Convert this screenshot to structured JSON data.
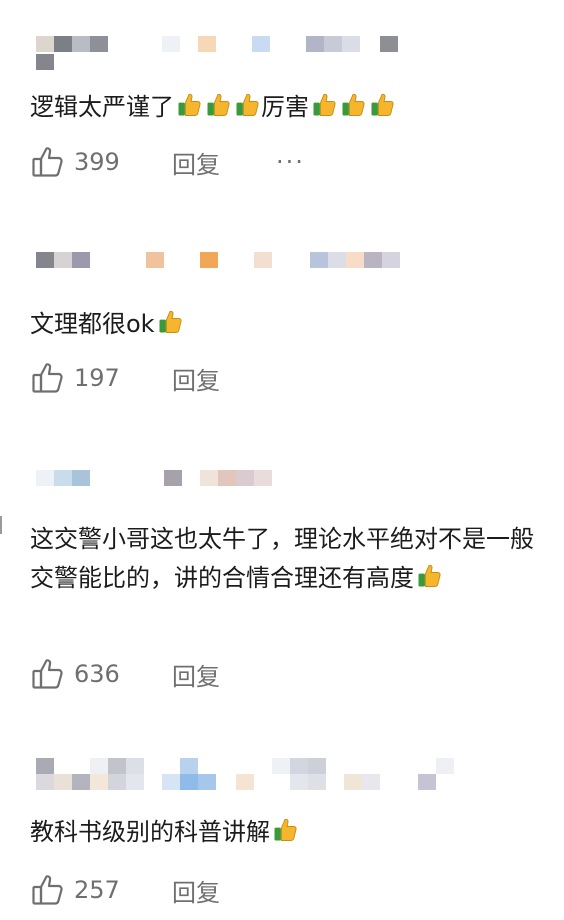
{
  "comments": [
    {
      "text": "逻辑太严谨了",
      "suffix": "厉害",
      "likes": "399",
      "reply": "回复",
      "more": "···"
    },
    {
      "text": "文理都很ok",
      "likes": "197",
      "reply": "回复"
    },
    {
      "text": "这交警小哥这也太牛了，理论水平绝对不是一般交警能比的，讲的合情合理还有高度",
      "likes": "636",
      "reply": "回复"
    },
    {
      "text": "教科书级别的科普讲解",
      "likes": "257",
      "reply": "回复"
    }
  ],
  "colors": {
    "text": "#1c1c1c",
    "muted": "#6f6f6f",
    "thumb_yellow": "#f5b62e",
    "thumb_green": "#3a9a3a"
  },
  "icons": {
    "like": "thumbs-up-outline-icon",
    "emoji": "thumbs-up-emoji-icon",
    "more": "more-dots-icon"
  }
}
